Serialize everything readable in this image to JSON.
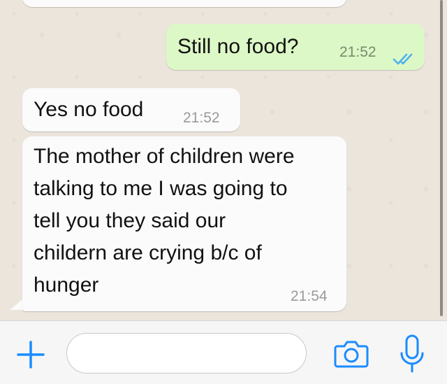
{
  "chat": {
    "messages": [
      {
        "direction": "outgoing",
        "text": "Still no food?",
        "time": "21:52",
        "status": "read-double-check"
      },
      {
        "direction": "incoming",
        "text": "Yes no food",
        "time": "21:52"
      },
      {
        "direction": "incoming",
        "text": "The mother of children were\ntalking to me I was going to\ntell you they said our\nchildern are crying b/c of\nhunger",
        "time": "21:54"
      }
    ]
  },
  "input_bar": {
    "icons": [
      "plus-icon",
      "camera-icon",
      "microphone-icon"
    ],
    "field_value": ""
  },
  "colors": {
    "accent": "#1a8cff",
    "outgoing_bubble": "#dcf8c6",
    "incoming_bubble": "#fbfbfb",
    "read_ticks": "#4fb1ee"
  }
}
